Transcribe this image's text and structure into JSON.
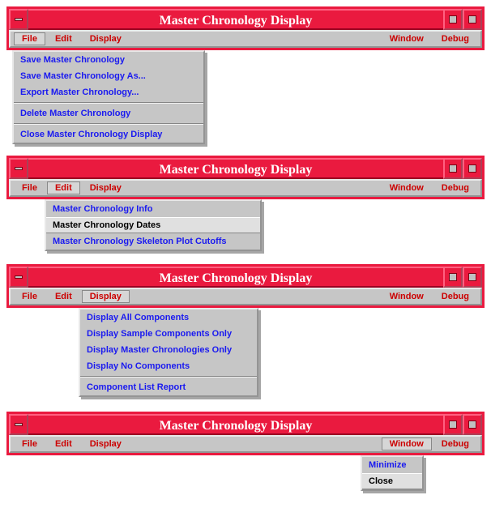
{
  "windows": [
    {
      "title": "Master Chronology Display",
      "menubar": {
        "file": "File",
        "edit": "Edit",
        "display": "Display",
        "window": "Window",
        "debug": "Debug"
      },
      "active_menu": "file",
      "dropdown": {
        "items": [
          "Save Master Chronology",
          "Save Master Chronology As...",
          "Export Master Chronology...",
          "---",
          "Delete Master Chronology",
          "---",
          "Close Master Chronology Display"
        ],
        "highlight_index": -1
      }
    },
    {
      "title": "Master Chronology Display",
      "menubar": {
        "file": "File",
        "edit": "Edit",
        "display": "Display",
        "window": "Window",
        "debug": "Debug"
      },
      "active_menu": "edit",
      "dropdown": {
        "items": [
          "Master Chronology Info",
          "Master Chronology Dates",
          "Master Chronology Skeleton Plot Cutoffs"
        ],
        "highlight_index": 1
      }
    },
    {
      "title": "Master Chronology Display",
      "menubar": {
        "file": "File",
        "edit": "Edit",
        "display": "Display",
        "window": "Window",
        "debug": "Debug"
      },
      "active_menu": "display",
      "dropdown": {
        "items": [
          "Display All Components",
          "Display Sample Components Only",
          "Display Master Chronologies Only",
          "Display No Components",
          "---",
          "Component List Report"
        ],
        "highlight_index": -1
      }
    },
    {
      "title": "Master Chronology Display",
      "menubar": {
        "file": "File",
        "edit": "Edit",
        "display": "Display",
        "window": "Window",
        "debug": "Debug"
      },
      "active_menu": "window",
      "dropdown": {
        "items": [
          "Minimize",
          "Close"
        ],
        "highlight_index": 1
      }
    }
  ]
}
